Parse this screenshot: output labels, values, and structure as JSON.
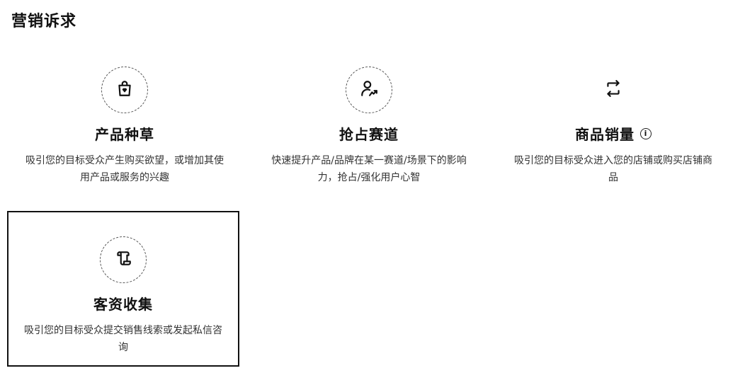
{
  "header": {
    "title": "营销诉求"
  },
  "cards": [
    {
      "icon": "shopping-bag-icon",
      "title": "产品种草",
      "description": "吸引您的目标受众产生购买欲望，或增加其使用产品或服务的兴趣",
      "selected": false,
      "info": ""
    },
    {
      "icon": "user-growth-icon",
      "title": "抢占赛道",
      "description": "快速提升产品/品牌在某一赛道/场景下的影响力，抢占/强化用户心智",
      "selected": false,
      "info": ""
    },
    {
      "icon": "exchange-icon",
      "title": "商品销量",
      "description": "吸引您的目标受众进入您的店铺或购买店铺商品",
      "selected": false,
      "info": "i"
    },
    {
      "icon": "scroll-icon",
      "title": "客资收集",
      "description": "吸引您的目标受众提交销售线索或发起私信咨询",
      "selected": true,
      "info": ""
    }
  ],
  "colors": {
    "text": "#111111",
    "muted": "#333333",
    "selected_border": "#111111"
  }
}
